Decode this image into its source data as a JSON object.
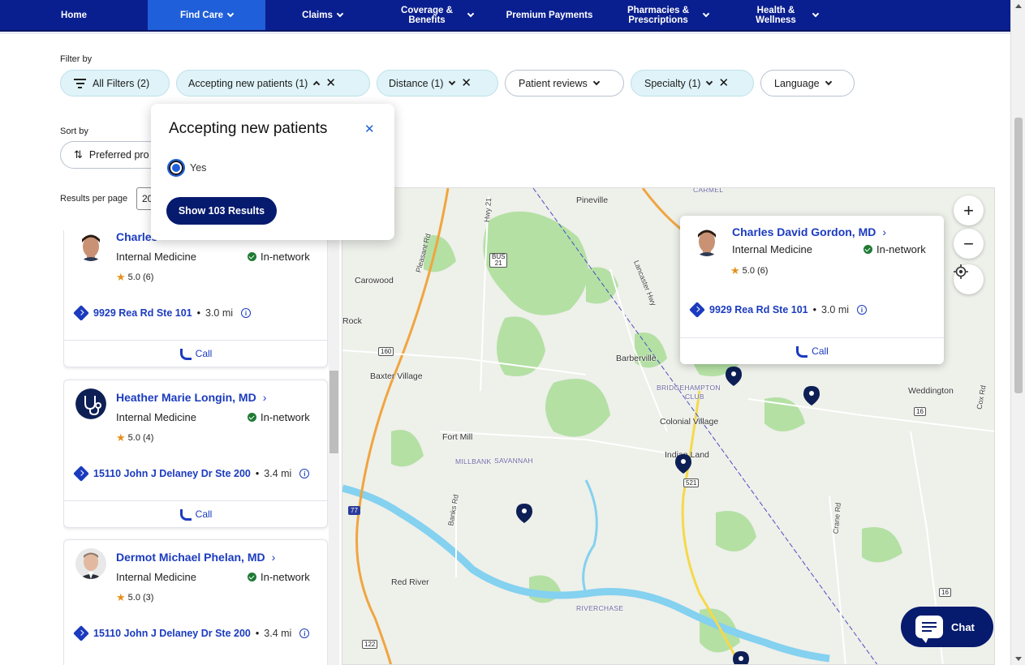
{
  "nav": {
    "items": [
      {
        "label": "Home",
        "chevron": false
      },
      {
        "label": "Find Care",
        "chevron": true,
        "active": true
      },
      {
        "label": "Claims",
        "chevron": true
      },
      {
        "label": "Coverage & Benefits",
        "chevron": true
      },
      {
        "label": "Premium Payments",
        "chevron": false
      },
      {
        "label": "Pharmacies & Prescriptions",
        "chevron": true
      },
      {
        "label": "Health & Wellness",
        "chevron": true
      }
    ]
  },
  "filters": {
    "label": "Filter by",
    "all_filters": "All Filters (2)",
    "accepting": "Accepting new patients (1)",
    "distance": "Distance (1)",
    "reviews": "Patient reviews",
    "specialty": "Specialty (1)",
    "language": "Language"
  },
  "sort": {
    "label": "Sort by",
    "value": "Preferred pro"
  },
  "results_per_page": {
    "label": "Results per page",
    "value": "20"
  },
  "popover": {
    "title": "Accepting new patients",
    "option": "Yes",
    "button": "Show 103 Results"
  },
  "providers": [
    {
      "name": "Charles",
      "specialty": "Internal Medicine",
      "network": "In-network",
      "rating": "5.0",
      "reviews": "(6)",
      "street": "9929 Rea Rd Ste 101",
      "distance": "3.0 mi",
      "call": "Call"
    },
    {
      "name": "Heather Marie Longin, MD",
      "specialty": "Internal Medicine",
      "network": "In-network",
      "rating": "5.0",
      "reviews": "(4)",
      "street": "15110 John J Delaney Dr Ste 200",
      "distance": "3.4 mi",
      "call": "Call"
    },
    {
      "name": "Dermot Michael Phelan, MD",
      "specialty": "Internal Medicine",
      "network": "In-network",
      "rating": "5.0",
      "reviews": "(3)",
      "street": "15110 John J Delaney Dr Ste 200",
      "distance": "3.4 mi",
      "call": "Call"
    }
  ],
  "map": {
    "popup": {
      "name": "Charles David Gordon, MD",
      "specialty": "Internal Medicine",
      "network": "In-network",
      "rating": "5.0",
      "reviews": "(6)",
      "street": "9929 Rea Rd Ste 101",
      "distance": "3.0 mi",
      "call": "Call"
    },
    "labels": {
      "pineville": "Pineville",
      "carowood": "Carowood",
      "rock": "Rock",
      "baxter": "Baxter Village",
      "barberville": "Barberville",
      "bridgehampton": "BRIDGEHAMPTON",
      "club": "CLUB",
      "colonial": "Colonial Village",
      "fortmill": "Fort Mill",
      "millbank": "MILLBANK",
      "savannah": "SAVANNAH",
      "indian": "Indian Land",
      "weddington": "Weddington",
      "redriver": "Red River",
      "riverchase": "RIVERCHASE",
      "hwy21": "Hwy 21",
      "pleasant": "Pleasant Rd",
      "lancaster": "Lancaster Hwy",
      "banks": "Banks Rd",
      "crane": "Crane Rd",
      "cox": "Cox Rd",
      "carmel": "CARMEL",
      "bus": "BUS",
      "bus_num": "21",
      "s160": "160",
      "s521": "521",
      "s16a": "16",
      "s16b": "16",
      "s122": "122",
      "s77": "77"
    },
    "zoom_in": "+",
    "zoom_out": "−"
  },
  "chat": "Chat",
  "colors": {
    "nav_bg": "#0a1f8f",
    "nav_active": "#1f5fd9",
    "link": "#1b3bbf",
    "chip_active": "#dff3f8",
    "dark_button": "#061a6e",
    "in_network": "#1f7a34",
    "star": "#e5901a",
    "map_bg": "#eef0ea",
    "map_green": "#b4e0a4",
    "map_water": "#84d1f0"
  }
}
